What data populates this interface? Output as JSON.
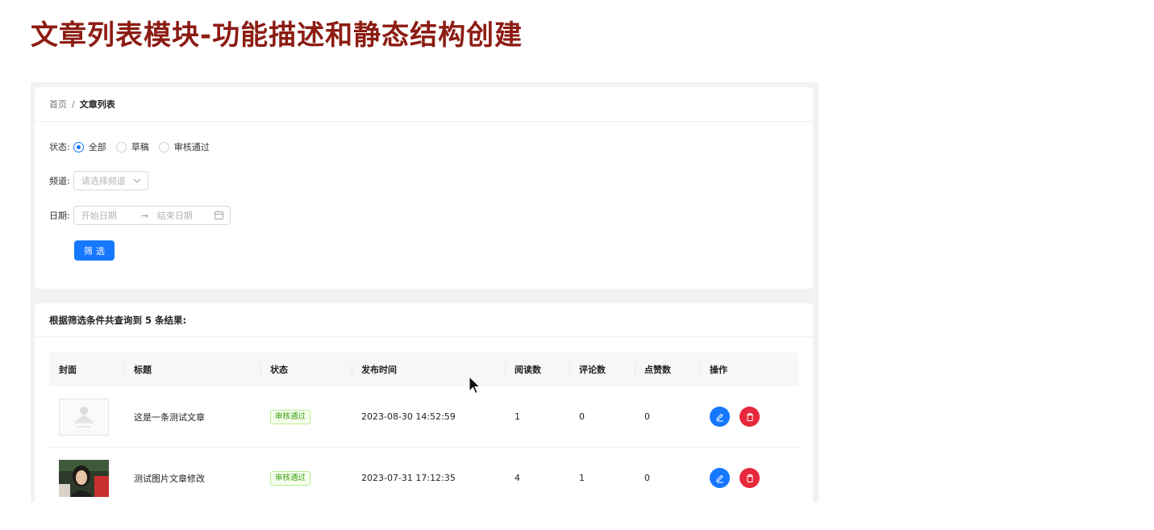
{
  "slide": {
    "title": "文章列表模块-功能描述和静态结构创建"
  },
  "breadcrumb": {
    "home": "首页",
    "separator": "/",
    "current": "文章列表"
  },
  "filter": {
    "status_label": "状态:",
    "status_options": [
      {
        "label": "全部",
        "checked": true
      },
      {
        "label": "草稿",
        "checked": false
      },
      {
        "label": "审核通过",
        "checked": false
      }
    ],
    "channel_label": "频道:",
    "channel_placeholder": "请选择频道",
    "date_label": "日期:",
    "date_start_placeholder": "开始日期",
    "date_arrow": "→",
    "date_end_placeholder": "结束日期",
    "submit_label": "筛选"
  },
  "results": {
    "summary": "根据筛选条件共查询到 5 条结果:",
    "columns": [
      "封面",
      "标题",
      "状态",
      "发布时间",
      "阅读数",
      "评论数",
      "点赞数",
      "操作"
    ],
    "rows": [
      {
        "cover": "placeholder",
        "title": "这是一条测试文章",
        "status": "审核通过",
        "pubdate": "2023-08-30 14:52:59",
        "reads": "1",
        "comments": "0",
        "likes": "0"
      },
      {
        "cover": "photo",
        "title": "测试图片文章修改",
        "status": "审核通过",
        "pubdate": "2023-07-31 17:12:35",
        "reads": "4",
        "comments": "1",
        "likes": "0"
      }
    ]
  },
  "colors": {
    "primary": "#1677ff",
    "danger": "#e8283b",
    "title": "#8c1c13",
    "success_text": "#389e0d"
  },
  "icons": {
    "edit": "edit-icon",
    "delete": "delete-icon",
    "dropdown": "chevron-down-icon",
    "calendar": "calendar-icon"
  }
}
